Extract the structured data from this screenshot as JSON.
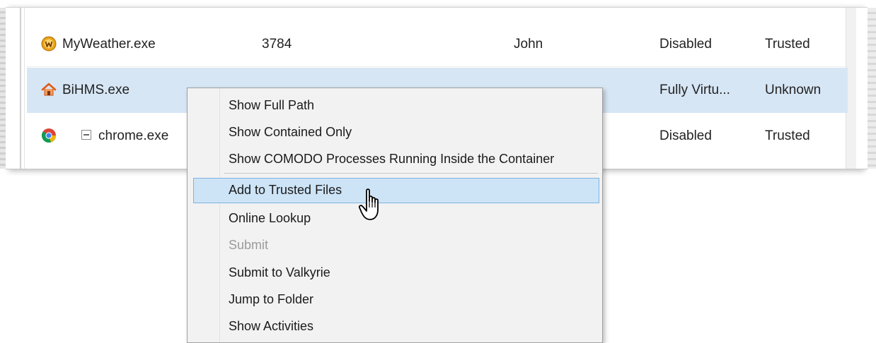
{
  "processes": [
    {
      "name": "MyWeather.exe",
      "pid": "3784",
      "user": "John",
      "virtualization": "Disabled",
      "rating": "Trusted",
      "icon": "weather-app-icon",
      "selected": false
    },
    {
      "name": "BiHMS.exe",
      "pid": "",
      "user": "",
      "virtualization": "Fully Virtu...",
      "rating": "Unknown",
      "icon": "house-icon",
      "selected": true
    },
    {
      "name": "chrome.exe",
      "pid": "",
      "user": "",
      "virtualization": "Disabled",
      "rating": "Trusted",
      "icon": "chrome-icon",
      "selected": false
    }
  ],
  "context_menu": {
    "items": [
      {
        "label": "Show Full Path",
        "state": "normal"
      },
      {
        "label": "Show Contained Only",
        "state": "normal"
      },
      {
        "label": "Show COMODO Processes Running Inside the Container",
        "state": "normal"
      },
      {
        "label": "Add to Trusted Files",
        "state": "hover"
      },
      {
        "label": "Online Lookup",
        "state": "normal"
      },
      {
        "label": "Submit",
        "state": "disabled"
      },
      {
        "label": "Submit to Valkyrie",
        "state": "normal"
      },
      {
        "label": "Jump to Folder",
        "state": "normal"
      },
      {
        "label": "Show Activities",
        "state": "normal"
      }
    ]
  },
  "colors": {
    "selection": "#d7e6f5",
    "menu_hover": "#cde4f7",
    "menu_background": "#f2f2f2",
    "disabled_text": "#9b9b9b"
  }
}
